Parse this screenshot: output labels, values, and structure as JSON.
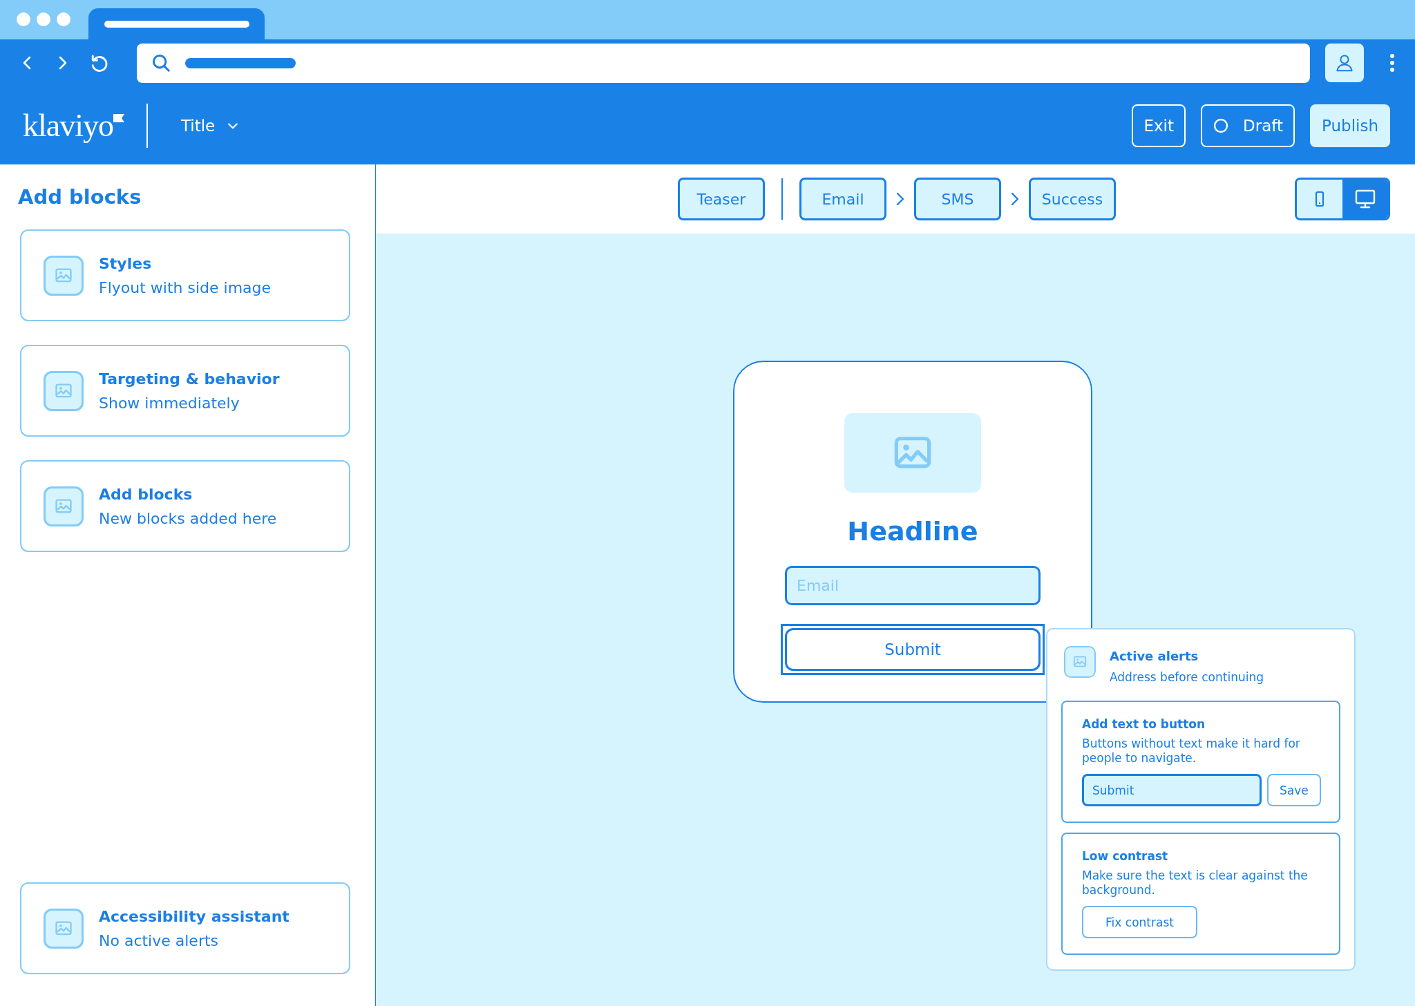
{
  "header": {
    "logo": "klaviyo",
    "title": "Title",
    "buttons": [
      {
        "kind": "outline",
        "label": "Exit"
      },
      {
        "kind": "draft",
        "label": "Draft"
      },
      {
        "kind": "primary",
        "label": "Publish"
      }
    ]
  },
  "sidebar": {
    "heading": "Add blocks",
    "cards": [
      {
        "title": "Styles",
        "subtitle": "Flyout with side image"
      },
      {
        "title": "Targeting & behavior",
        "subtitle": "Show immediately"
      },
      {
        "title": "Add blocks",
        "subtitle": "New blocks added here"
      }
    ],
    "footer_card": {
      "title": "Accessibility assistant",
      "subtitle": "No active alerts"
    }
  },
  "steps": [
    {
      "kind": "step",
      "label": "Teaser"
    },
    {
      "kind": "divider"
    },
    {
      "kind": "step",
      "label": "Email"
    },
    {
      "kind": "chevron"
    },
    {
      "kind": "step",
      "label": "SMS"
    },
    {
      "kind": "chevron"
    },
    {
      "kind": "step",
      "label": "Success"
    }
  ],
  "device_toggle": [
    {
      "kind": "mobile",
      "selected": false
    },
    {
      "kind": "desktop",
      "selected": true
    }
  ],
  "form": {
    "headline": "Headline",
    "email_placeholder": "Email",
    "submit": "Submit",
    "submit_selected": true
  },
  "alerts_panel": {
    "title": "Active alerts",
    "subtitle": "Address before continuing",
    "alerts": [
      {
        "kind": "edit",
        "title": "Add text to button",
        "text": "Buttons without text make it hard for people to navigate.",
        "value": "Submit",
        "action": "Save"
      },
      {
        "kind": "action",
        "title": "Low contrast",
        "text": "Make sure the text is clear against the background.",
        "action": "Fix contrast"
      }
    ]
  }
}
